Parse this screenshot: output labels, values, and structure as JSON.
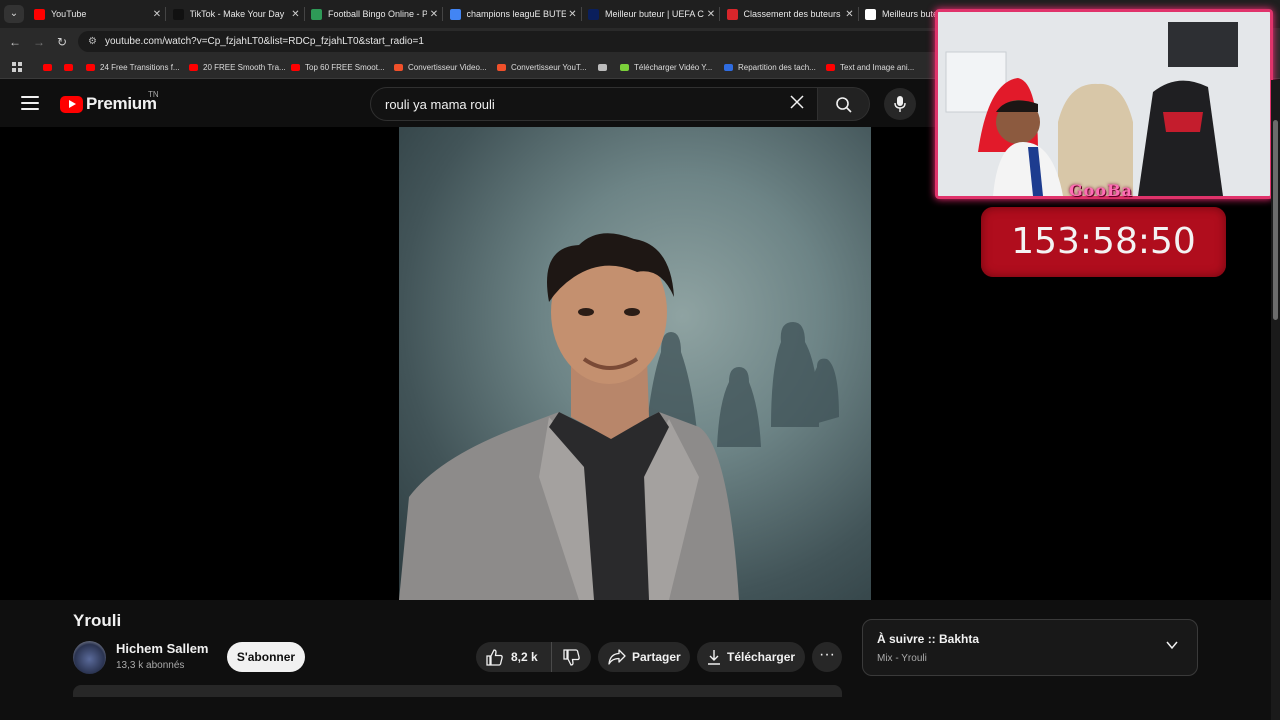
{
  "browser": {
    "tabs": [
      {
        "label": "YouTube",
        "favicon_color": "#ff0000"
      },
      {
        "label": "TikTok - Make Your Day",
        "favicon_color": "#111111"
      },
      {
        "label": "Football Bingo Online - P",
        "favicon_color": "#2e9a57"
      },
      {
        "label": "champions leaguE BUTEU",
        "favicon_color": "#4285f4"
      },
      {
        "label": "Meilleur buteur | UEFA Ch",
        "favicon_color": "#0a1f5c"
      },
      {
        "label": "Classement des buteurs L",
        "favicon_color": "#d8262b"
      },
      {
        "label": "Meilleurs buteurs",
        "favicon_color": "#ffffff"
      }
    ],
    "url": "youtube.com/watch?v=Cp_fzjahLT0&list=RDCp_fzjahLT0&start_radio=1",
    "bookmarks": [
      {
        "label": "",
        "color": "#ff0000"
      },
      {
        "label": "",
        "color": "#ff0000"
      },
      {
        "label": "24 Free Transitions f...",
        "color": "#ff0000"
      },
      {
        "label": "20 FREE Smooth Tra...",
        "color": "#ff0000"
      },
      {
        "label": "Top 60 FREE Smoot...",
        "color": "#ff0000"
      },
      {
        "label": "Convertisseur Video...",
        "color": "#f0502a"
      },
      {
        "label": "Convertisseur YouT...",
        "color": "#f0502a"
      },
      {
        "label": "",
        "color": "#bbbbbb"
      },
      {
        "label": "Télécharger Vidéo Y...",
        "color": "#7bd03a"
      },
      {
        "label": "Repartition des tach...",
        "color": "#2f6ce0"
      },
      {
        "label": "Text and Image ani...",
        "color": "#ff0000"
      }
    ]
  },
  "header": {
    "logo_text": "Premium",
    "country_code": "TN",
    "search_query": "rouli ya mama rouli"
  },
  "overlay": {
    "streamer_name": "GooBa",
    "timer": "153:58:50"
  },
  "video": {
    "title": "Yrouli",
    "channel_name": "Hichem Sallem",
    "subscribers": "13,3 k abonnés",
    "subscribe_label": "S'abonner",
    "likes": "8,2 k",
    "share_label": "Partager",
    "download_label": "Télécharger",
    "more_label": "···"
  },
  "up_next": {
    "title": "À suivre :: Bakhta",
    "subtitle": "Mix - Yrouli"
  },
  "colors": {
    "accent": "#ff0000",
    "timer_bg": "#b00d1d",
    "cam_border": "#e0336b"
  }
}
